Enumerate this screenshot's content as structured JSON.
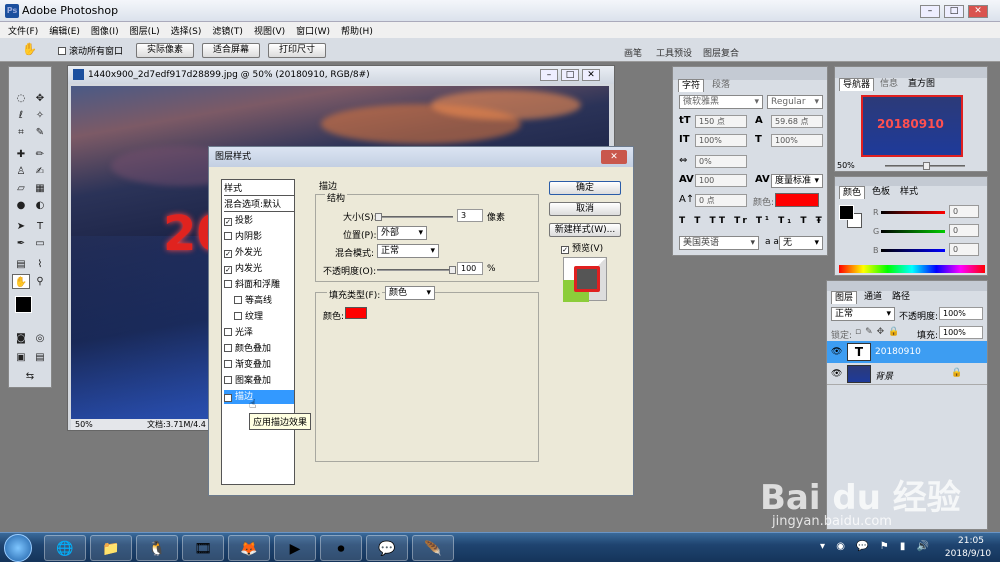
{
  "app": {
    "title": "Adobe Photoshop",
    "icon": "photoshop-icon"
  },
  "menu": [
    "文件(F)",
    "编辑(E)",
    "图像(I)",
    "图层(L)",
    "选择(S)",
    "滤镜(T)",
    "视图(V)",
    "窗口(W)",
    "帮助(H)"
  ],
  "options_bar": {
    "scroll_all": "滚动所有窗口",
    "actual_pixels": "实际像素",
    "fit_screen": "适合屏幕",
    "print_size": "打印尺寸",
    "tabs": [
      "画笔",
      "工具预设",
      "图层复合"
    ]
  },
  "document": {
    "title": "1440x900_2d7edf917d28899.jpg @ 50% (20180910, RGB/8#)",
    "canvas_text": "20",
    "zoom": "50%",
    "doc_info": "文档:3.71M/4.4"
  },
  "char_panel": {
    "tabs": [
      "字符",
      "段落"
    ],
    "font": "微软雅黑",
    "style": "Regular",
    "size": "150 点",
    "leading": "59.68 点",
    "v_scale": "100%",
    "h_scale": "100%",
    "tracking": "0%",
    "kerning_value": "100",
    "kerning_mode": "度量标准",
    "baseline": "0 点",
    "color_label": "颜色:",
    "language": "美国英语",
    "aa_label": "a a",
    "antialias": "无"
  },
  "navigator": {
    "tabs": [
      "导航器",
      "信息",
      "直方图"
    ],
    "thumb_text": "20180910",
    "zoom": "50%"
  },
  "color_panel": {
    "tabs": [
      "颜色",
      "色板",
      "样式"
    ],
    "r": "0",
    "g": "0",
    "b": "0",
    "r_lbl": "R",
    "g_lbl": "G",
    "b_lbl": "B"
  },
  "layers": {
    "tabs": [
      "图层",
      "通道",
      "路径"
    ],
    "blend_mode": "正常",
    "opacity_label": "不透明度:",
    "opacity": "100%",
    "lock_label": "锁定:",
    "fill_label": "填充:",
    "fill": "100%",
    "items": [
      {
        "name": "20180910",
        "thumb": "T",
        "selected": true
      },
      {
        "name": "背景",
        "thumb": "",
        "selected": false
      }
    ]
  },
  "dialog": {
    "title": "图层样式",
    "styles_header": "样式",
    "styles": [
      {
        "label": "混合选项:默认",
        "checkbox": false,
        "checked": false
      },
      {
        "label": "投影",
        "checkbox": true,
        "checked": true
      },
      {
        "label": "内阴影",
        "checkbox": true,
        "checked": false
      },
      {
        "label": "外发光",
        "checkbox": true,
        "checked": true
      },
      {
        "label": "内发光",
        "checkbox": true,
        "checked": true
      },
      {
        "label": "斜面和浮雕",
        "checkbox": true,
        "checked": false
      },
      {
        "label": "等高线",
        "checkbox": true,
        "checked": false
      },
      {
        "label": "纹理",
        "checkbox": true,
        "checked": false
      },
      {
        "label": "光泽",
        "checkbox": true,
        "checked": false
      },
      {
        "label": "颜色叠加",
        "checkbox": true,
        "checked": false
      },
      {
        "label": "渐变叠加",
        "checkbox": true,
        "checked": false
      },
      {
        "label": "图案叠加",
        "checkbox": true,
        "checked": false
      },
      {
        "label": "描边",
        "checkbox": true,
        "checked": true
      }
    ],
    "tooltip": "应用描边效果",
    "section": "描边",
    "structure": "结构",
    "size_label": "大小(S):",
    "size_value": "3",
    "size_unit": "像素",
    "position_label": "位置(P):",
    "position": "外部",
    "blend_label": "混合模式:",
    "blend": "正常",
    "opacity_label": "不透明度(O):",
    "opacity_value": "100",
    "opacity_unit": "%",
    "fill_type_label": "填充类型(F):",
    "fill_type": "颜色",
    "color_label": "颜色:",
    "stroke_color": "#ff0000",
    "ok": "确定",
    "cancel": "取消",
    "new_style": "新建样式(W)...",
    "preview": "预览(V)"
  },
  "watermark": {
    "brand": "Bai du 经验",
    "url": "jingyan.baidu.com"
  },
  "taskbar": {
    "time": "21:05",
    "date": "2018/9/10"
  }
}
